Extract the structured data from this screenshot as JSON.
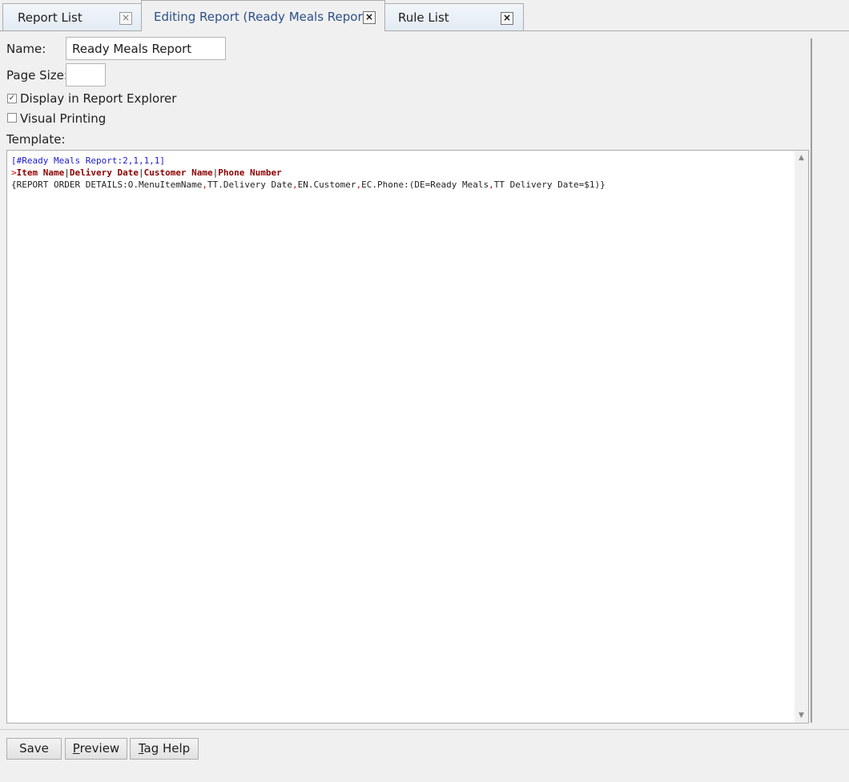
{
  "tabs": [
    {
      "label": "Report List",
      "active": false
    },
    {
      "label": "Editing Report (Ready Meals Report)",
      "active": true
    },
    {
      "label": "Rule List",
      "active": false
    }
  ],
  "close_glyph": "×",
  "form": {
    "name_label": "Name:",
    "name_value": "Ready Meals Report",
    "page_size_label": "Page Size:",
    "page_size_value": "",
    "display_in_explorer_label": "Display in Report Explorer",
    "display_in_explorer_checked": true,
    "visual_printing_label": "Visual Printing",
    "visual_printing_checked": false,
    "template_label": "Template:"
  },
  "template": {
    "line1": "[#Ready Meals Report:2,1,1,1]",
    "line2": {
      "marker": ">",
      "cols": [
        "Item Name",
        "Delivery Date",
        "Customer Name",
        "Phone Number"
      ],
      "sep": "|"
    },
    "line3": {
      "open": "{REPORT ORDER DETAILS:",
      "f1": "O.MenuItemName",
      "comma": ",",
      "f2": "TT.Delivery Date",
      "f3": "EN.Customer",
      "f4": "EC.Phone:",
      "cond1": "(DE=Ready Meals",
      "cond2": "TT Delivery Date=$1)}"
    }
  },
  "scroll": {
    "up": "▲",
    "down": "▼"
  },
  "buttons": {
    "save": "Save",
    "preview_first": "P",
    "preview_rest": "review",
    "taghelp_first": "T",
    "taghelp_rest": "ag Help"
  },
  "check_glyph": "✓"
}
